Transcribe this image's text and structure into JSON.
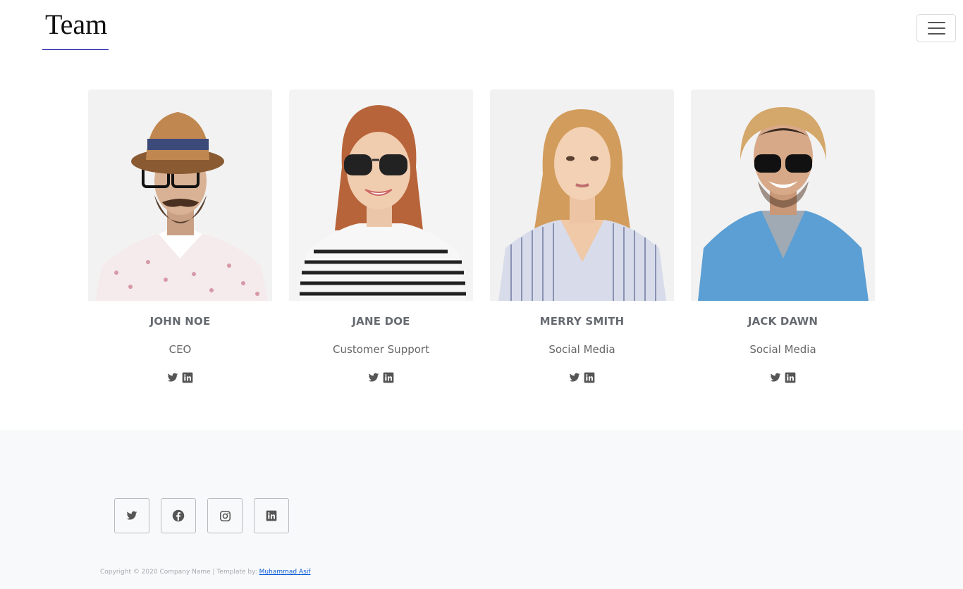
{
  "header": {
    "title": "Team",
    "menu_icon": "hamburger-icon"
  },
  "team": [
    {
      "name": "JOHN NOE",
      "role": "CEO",
      "icons": [
        "twitter-icon",
        "linkedin-icon"
      ]
    },
    {
      "name": "JANE DOE",
      "role": "Customer Support",
      "icons": [
        "twitter-icon",
        "linkedin-icon"
      ]
    },
    {
      "name": "MERRY SMITH",
      "role": "Social Media",
      "icons": [
        "twitter-icon",
        "linkedin-icon"
      ]
    },
    {
      "name": "JACK DAWN",
      "role": "Social Media",
      "icons": [
        "twitter-icon",
        "linkedin-icon"
      ]
    }
  ],
  "footer": {
    "social_icons": [
      "twitter-icon",
      "facebook-icon",
      "instagram-icon",
      "linkedin-icon"
    ],
    "copyright_text": "Copyright © 2020 Company Name | Template by: ",
    "author_link": "Muhammad Asif"
  },
  "colors": {
    "accent_underline": "#1a1aa6",
    "footer_bg": "#f8f9fa",
    "link": "#0b5cd6",
    "icon": "#555555"
  }
}
